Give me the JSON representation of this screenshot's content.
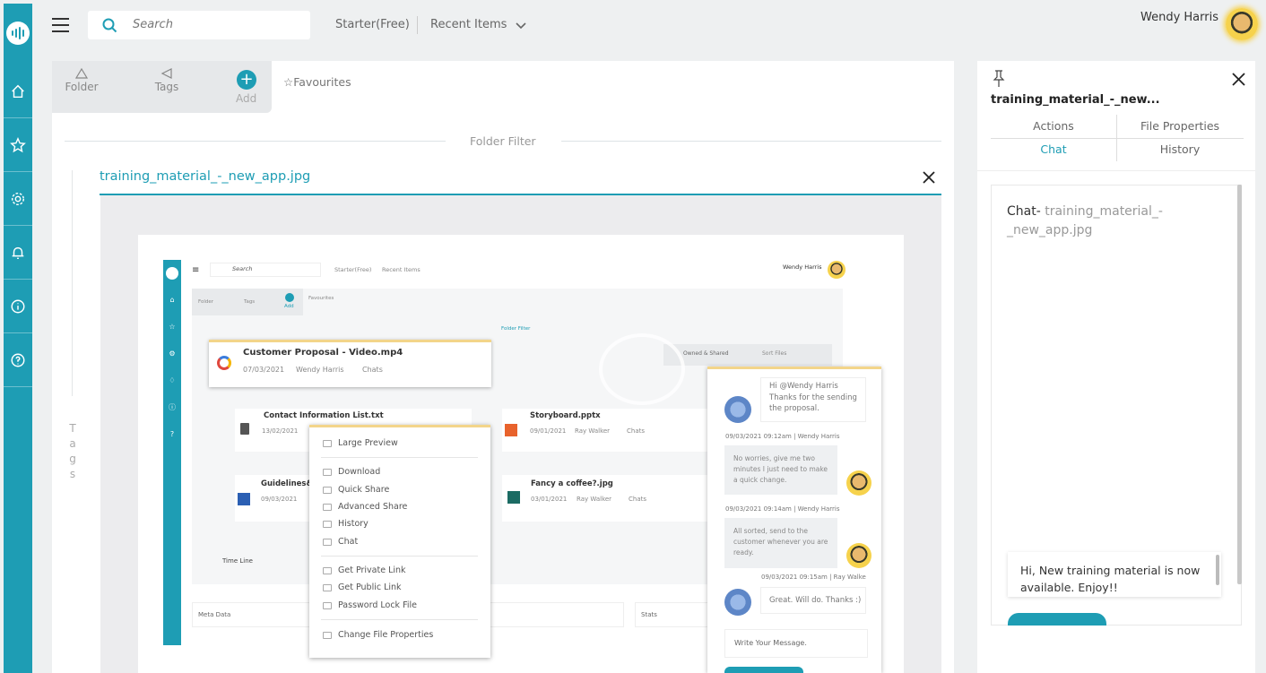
{
  "topbar": {
    "search_placeholder": "Search",
    "plan": "Starter(Free)",
    "recent": "Recent Items",
    "user_name": "Wendy Harris"
  },
  "filters": {
    "folder": "Folder",
    "tags": "Tags",
    "add": "Add",
    "favourites": "Favourites",
    "folder_filter": "Folder Filter"
  },
  "side_tags_label": [
    "T",
    "a",
    "g",
    "s"
  ],
  "preview": {
    "file_name": "training_material_-_new_app.jpg"
  },
  "inner": {
    "search": "Search",
    "plan": "Starter(Free)",
    "recent": "Recent Items",
    "user": "Wendy Harris",
    "folder": "Folder",
    "tags": "Tags",
    "add": "Add",
    "favourites": "Favourites",
    "folder_filter": "Folder Filter",
    "shared": "Owned & Shared",
    "sort": "Sort Files",
    "card1_title": "Customer Proposal - Video.mp4",
    "card1_date": "07/03/2021",
    "card1_user": "Wendy Harris",
    "card1_chats": "Chats",
    "card2_title": "Contact Information List.txt",
    "card2_date": "13/02/2021",
    "card3_title": "Storyboard.pptx",
    "card3_date": "09/01/2021",
    "card3_user": "Ray Walker",
    "card3_chats": "Chats",
    "card4_title": "Guidelines&t",
    "card4_date": "09/03/2021",
    "card5_title": "Fancy a coffee?.jpg",
    "card5_date": "03/01/2021",
    "card5_user": "Ray Walker",
    "card5_chats": "Chats",
    "timeline": "Time Line",
    "meta": "Meta Data",
    "stats": "Stats",
    "menu": [
      "Large Preview",
      "Download",
      "Quick Share",
      "Advanced Share",
      "History",
      "Chat",
      "Get Private Link",
      "Get Public Link",
      "Password Lock File",
      "Change File Properties"
    ],
    "chat1": "Hi @Wendy Harris Thanks for the sending the proposal.",
    "chat1_meta": "09/03/2021 09:12am | Wendy Harris",
    "chat2": "No worries, give me two minutes I just need to make a quick change.",
    "chat2_meta": "09/03/2021 09:14am | Wendy Harris",
    "chat3": "All sorted, send to the customer whenever you are ready.",
    "chat3_meta": "09/03/2021 09:15am | Ray Walke",
    "chat4": "Great. Will do. Thanks :)",
    "write": "Write Your Message."
  },
  "side": {
    "title": "training_material_-_new...",
    "tabs": [
      "Actions",
      "File Properties",
      "Chat",
      "History"
    ],
    "chat_prefix": "Chat-",
    "chat_file_line1": "training_material_-",
    "chat_file_line2": "_new_app.jpg",
    "message": "Hi, New training material is now available. Enjoy!!"
  },
  "colors": {
    "accent": "#1e9db4",
    "card_top": "#f3d58a"
  }
}
